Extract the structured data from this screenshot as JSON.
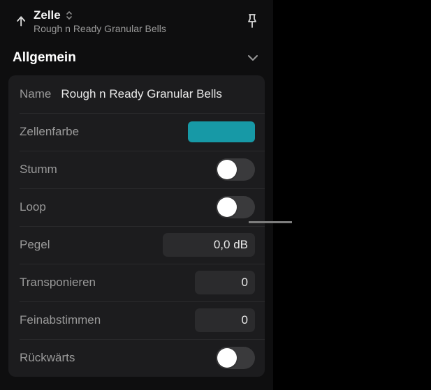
{
  "header": {
    "title": "Zelle",
    "subtitle": "Rough n Ready Granular Bells"
  },
  "section": {
    "title": "Allgemein"
  },
  "rows": {
    "name": {
      "label": "Name",
      "value": "Rough n Ready Granular Bells"
    },
    "color": {
      "label": "Zellenfarbe",
      "swatch": "#1799a6"
    },
    "mute": {
      "label": "Stumm",
      "on": false
    },
    "loop": {
      "label": "Loop",
      "on": false
    },
    "level": {
      "label": "Pegel",
      "value": "0,0 dB"
    },
    "transpose": {
      "label": "Transponieren",
      "value": "0"
    },
    "finetune": {
      "label": "Feinabstimmen",
      "value": "0"
    },
    "reverse": {
      "label": "Rückwärts",
      "on": false
    }
  }
}
